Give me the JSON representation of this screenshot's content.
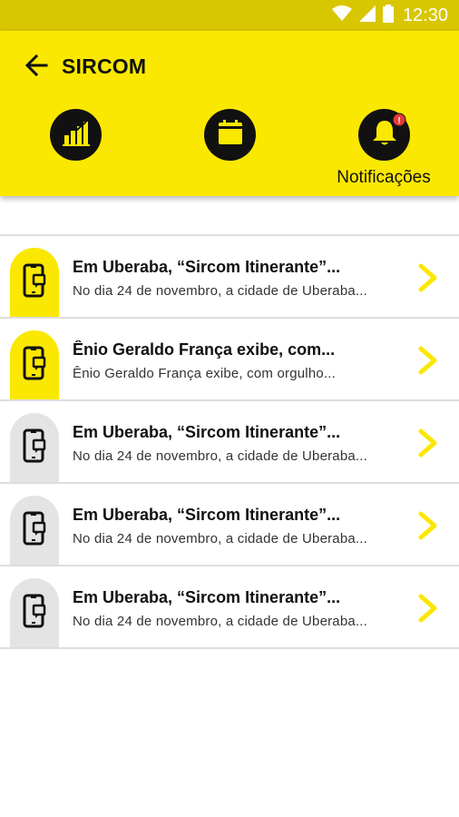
{
  "status_bar": {
    "time": "12:30",
    "icons": [
      "wifi-icon",
      "signal-icon",
      "battery-icon"
    ]
  },
  "header": {
    "title": "SIRCOM",
    "back_icon": "arrow-left-icon",
    "nav": [
      {
        "icon": "chart-icon",
        "label": ""
      },
      {
        "icon": "calendar-icon",
        "label": ""
      },
      {
        "icon": "bell-icon",
        "label": "Notificações",
        "badge": "!"
      }
    ]
  },
  "notifications": [
    {
      "title": "Em Uberaba, “Sircom Itinerante”...",
      "subtitle": "No dia 24 de novembro, a cidade de Uberaba...",
      "read": false
    },
    {
      "title": "Ênio Geraldo França exibe, com...",
      "subtitle": "Ênio Geraldo França exibe, com orgulho...",
      "read": false
    },
    {
      "title": "Em Uberaba, “Sircom Itinerante”...",
      "subtitle": "No dia 24 de novembro, a cidade de Uberaba...",
      "read": true
    },
    {
      "title": "Em Uberaba, “Sircom Itinerante”...",
      "subtitle": "No dia 24 de novembro, a cidade de Uberaba...",
      "read": true
    },
    {
      "title": "Em Uberaba, “Sircom Itinerante”...",
      "subtitle": "No dia 24 de novembro, a cidade de Uberaba...",
      "read": true
    }
  ],
  "colors": {
    "accent": "#fae800",
    "status_bar": "#d8c600",
    "badge": "#e53935",
    "read_icon_bg": "#e4e4e4",
    "dark": "#111111"
  }
}
